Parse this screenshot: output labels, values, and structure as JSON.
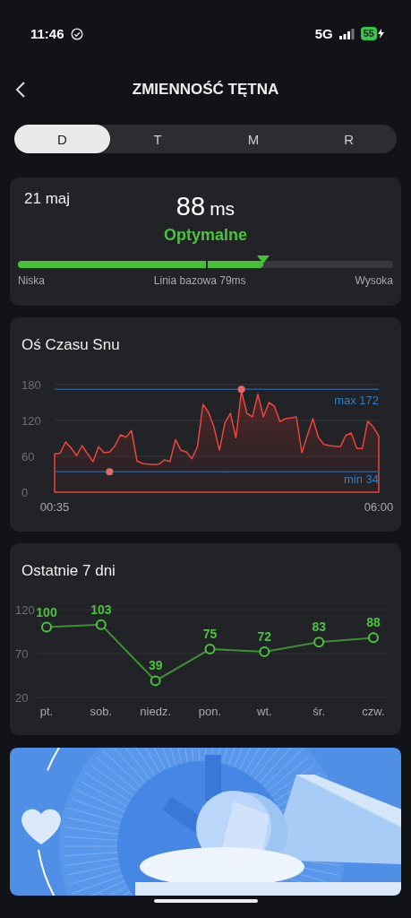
{
  "status_bar": {
    "time": "11:46",
    "network": "5G",
    "battery": "55"
  },
  "header": {
    "title": "ZMIENNOŚĆ TĘTNA"
  },
  "tabs": [
    {
      "label": "D",
      "selected": true
    },
    {
      "label": "T",
      "selected": false
    },
    {
      "label": "M",
      "selected": false
    },
    {
      "label": "R",
      "selected": false
    }
  ],
  "summary": {
    "date": "21 maj",
    "value": "88",
    "unit": "ms",
    "status": "Optymalne",
    "level": 0.653,
    "low_label": "Niska",
    "baseline_label": "Linia bazowa 79ms",
    "high_label": "Wysoka"
  },
  "sleep_timeline": {
    "title": "Oś Czasu Snu",
    "chart_data": {
      "type": "area",
      "ylim": [
        0,
        180
      ],
      "yticks": [
        0,
        60,
        120,
        180
      ],
      "categories": [
        "00:35",
        null,
        null,
        null,
        null,
        null,
        null,
        null,
        null,
        null,
        null,
        null,
        null,
        null,
        null,
        null,
        null,
        null,
        null,
        null,
        null,
        null,
        null,
        null,
        null,
        null,
        null,
        null,
        null,
        null,
        null,
        null,
        null,
        null,
        null,
        null,
        null,
        null,
        null,
        null,
        null,
        null,
        null,
        null,
        null,
        null,
        null,
        null,
        null,
        null,
        null,
        null,
        null,
        null,
        null,
        null,
        null,
        null,
        null,
        "06:00"
      ],
      "series": [
        {
          "color": "#e8463f",
          "values": [
            64,
            65,
            84,
            74,
            61,
            78,
            64,
            51,
            76,
            66,
            67,
            78,
            96,
            92,
            103,
            52,
            48,
            47,
            46,
            47,
            54,
            51,
            88,
            70,
            67,
            56,
            76,
            147,
            134,
            109,
            70,
            116,
            132,
            91,
            169,
            132,
            126,
            164,
            126,
            150,
            144,
            118,
            123,
            124,
            126,
            66,
            95,
            123,
            92,
            80,
            78,
            77,
            76,
            95,
            99,
            73,
            73,
            119,
            109,
            94
          ]
        },
        {
          "type": "scatter",
          "color": "#e36a68",
          "marker": "circle",
          "values": [
            null,
            null,
            null,
            null,
            null,
            null,
            null,
            null,
            null,
            null,
            34,
            null,
            null,
            null,
            null,
            null,
            null,
            null,
            null,
            null,
            null,
            null,
            null,
            null,
            null,
            null,
            null,
            null,
            null,
            null,
            null,
            null,
            null,
            null,
            172,
            null,
            null,
            null,
            null,
            null,
            null,
            null,
            null,
            null,
            null,
            null,
            null,
            null,
            null,
            null,
            null,
            null,
            null,
            null,
            null,
            null,
            null,
            null,
            null,
            null
          ]
        }
      ],
      "ref_lines": [
        {
          "axis": "y",
          "value": 172,
          "label": "max 172"
        },
        {
          "axis": "y",
          "value": 34,
          "label": "min 34"
        }
      ]
    }
  },
  "last_7_days": {
    "title": "Ostatnie 7 dni",
    "chart_data": {
      "type": "line",
      "categories": [
        "pt.",
        "sob.",
        "niedz.",
        "pon.",
        "wt.",
        "śr.",
        "czw."
      ],
      "ylim": [
        20,
        120
      ],
      "yticks": [
        20,
        70,
        120
      ],
      "data_labels": true,
      "series": [
        {
          "color": "#4cc23f",
          "marker": "circle",
          "values": [
            100,
            103,
            39,
            75,
            72,
            83,
            88
          ]
        }
      ]
    }
  }
}
